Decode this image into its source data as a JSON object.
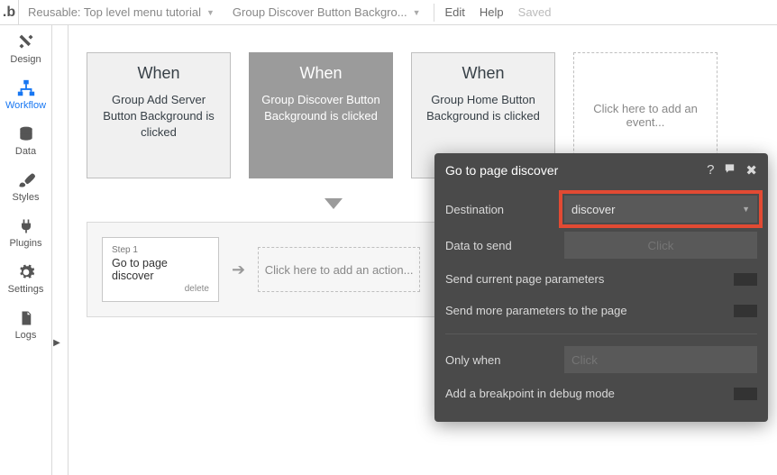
{
  "topbar": {
    "logo": ".b",
    "page_dd": "Reusable: Top level menu tutorial",
    "element_dd": "Group Discover Button Backgro...",
    "edit": "Edit",
    "help": "Help",
    "saved": "Saved"
  },
  "sidebar": {
    "design": "Design",
    "workflow": "Workflow",
    "data": "Data",
    "styles": "Styles",
    "plugins": "Plugins",
    "settings": "Settings",
    "logs": "Logs"
  },
  "events": {
    "e1_head": "When",
    "e1_body": "Group Add Server Button Background is clicked",
    "e2_head": "When",
    "e2_body": "Group Discover Button Background is clicked",
    "e3_head": "When",
    "e3_body": "Group Home Button Background is clicked",
    "add": "Click here to add an event..."
  },
  "actions": {
    "step_n": "Step 1",
    "step_t": "Go to page discover",
    "step_d": "delete",
    "add": "Click here to add an action..."
  },
  "panel": {
    "title": "Go to page discover",
    "destination_label": "Destination",
    "destination_value": "discover",
    "data_label": "Data to send",
    "data_placeholder": "Click",
    "send_current": "Send current page parameters",
    "send_more": "Send more parameters to the page",
    "only_when_label": "Only when",
    "only_when_placeholder": "Click",
    "breakpoint": "Add a breakpoint in debug mode"
  }
}
